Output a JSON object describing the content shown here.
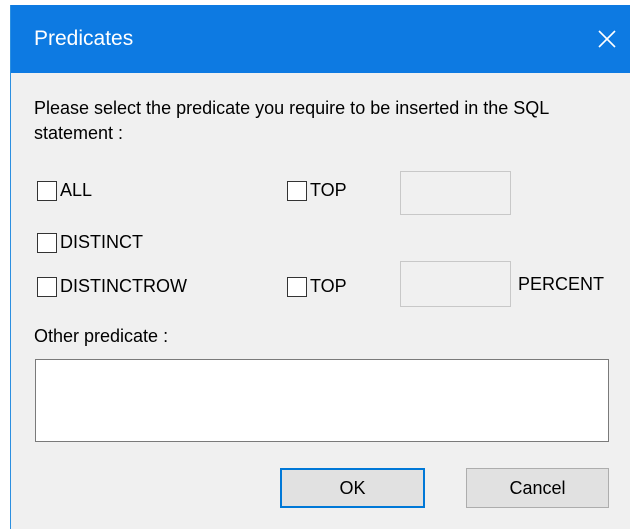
{
  "window": {
    "title": "Predicates",
    "accent_color": "#0d7ae2",
    "close_icon": "close-icon"
  },
  "prompt": "Please select the predicate you require to be inserted in the SQL statement :",
  "checkboxes": {
    "all": {
      "label": "ALL",
      "checked": false
    },
    "top": {
      "label": "TOP",
      "checked": false
    },
    "distinct": {
      "label": "DISTINCT",
      "checked": false
    },
    "distinctrow": {
      "label": "DISTINCTROW",
      "checked": false
    },
    "top_percent": {
      "label": "TOP",
      "checked": false
    }
  },
  "inputs": {
    "top_value": "",
    "top_percent_value": "",
    "percent_label": "PERCENT"
  },
  "other": {
    "label": "Other predicate :",
    "value": ""
  },
  "buttons": {
    "ok": "OK",
    "cancel": "Cancel"
  }
}
